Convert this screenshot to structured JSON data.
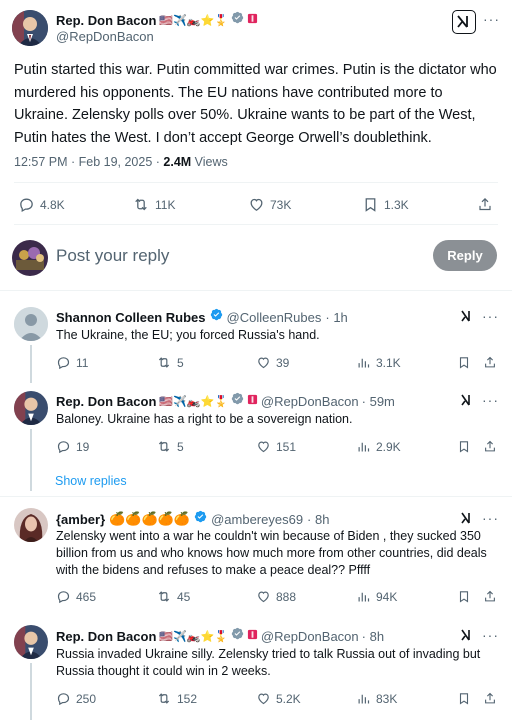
{
  "main_post": {
    "name": "Rep. Don Bacon",
    "name_emojis": "🇺🇸✈️🏍️⭐🎖️",
    "handle": "@RepDonBacon",
    "text": "Putin started this war. Putin committed war crimes. Putin is the dictator who murdered his opponents. The EU nations have contributed more to Ukraine. Zelensky polls over 50%. Ukraine wants to be part of the West, Putin hates the West. I don’t accept George Orwell’s doublethink.",
    "time": "12:57 PM · Feb 19, 2025 · ",
    "views_count": "2.4M",
    "views_label": "Views",
    "replies": "4.8K",
    "reposts": "11K",
    "likes": "73K",
    "bookmarks": "1.3K"
  },
  "composer": {
    "placeholder": "Post your reply",
    "reply_button": "Reply"
  },
  "replies": [
    {
      "name": "Shannon Colleen Rubes",
      "name_emojis": "",
      "handle": "@ColleenRubes",
      "time": "· 1h",
      "text": "The Ukraine, the EU; you forced Russia's hand.",
      "replies": "11",
      "reposts": "5",
      "likes": "39",
      "views": "3.1K"
    },
    {
      "name": "Rep. Don Bacon",
      "name_emojis": "🇺🇸✈️🏍️⭐🎖️",
      "handle": "@RepDonBacon",
      "time": "· 59m",
      "text": "Baloney. Ukraine has a right to be a sovereign nation.",
      "replies": "19",
      "reposts": "5",
      "likes": "151",
      "views": "2.9K"
    },
    {
      "name": "{amber}",
      "name_emojis": "🍊🍊🍊🍊🍊",
      "handle": "@ambereyes69",
      "time": "· 8h",
      "text": "Zelensky went into a war he couldn't win because of Biden , they sucked 350 billion from us and who knows how much more from other countries, did deals with the bidens and refuses to make a peace deal?? Pffff",
      "replies": "465",
      "reposts": "45",
      "likes": "888",
      "views": "94K"
    },
    {
      "name": "Rep. Don Bacon",
      "name_emojis": "🇺🇸✈️🏍️⭐🎖️",
      "handle": "@RepDonBacon",
      "time": "· 8h",
      "text": "Russia invaded Ukraine silly. Zelensky tried to talk Russia out of invading but Russia thought it could win in 2 weeks.",
      "replies": "250",
      "reposts": "152",
      "likes": "5.2K",
      "views": "83K"
    }
  ],
  "show_replies": "Show replies",
  "colors": {
    "accent": "#1d9bf0",
    "verified_blue": "#1d9bf0",
    "verified_gray": "#829aab",
    "reply_button_bg": "#8b9095",
    "gift_red": "#e0245e"
  }
}
